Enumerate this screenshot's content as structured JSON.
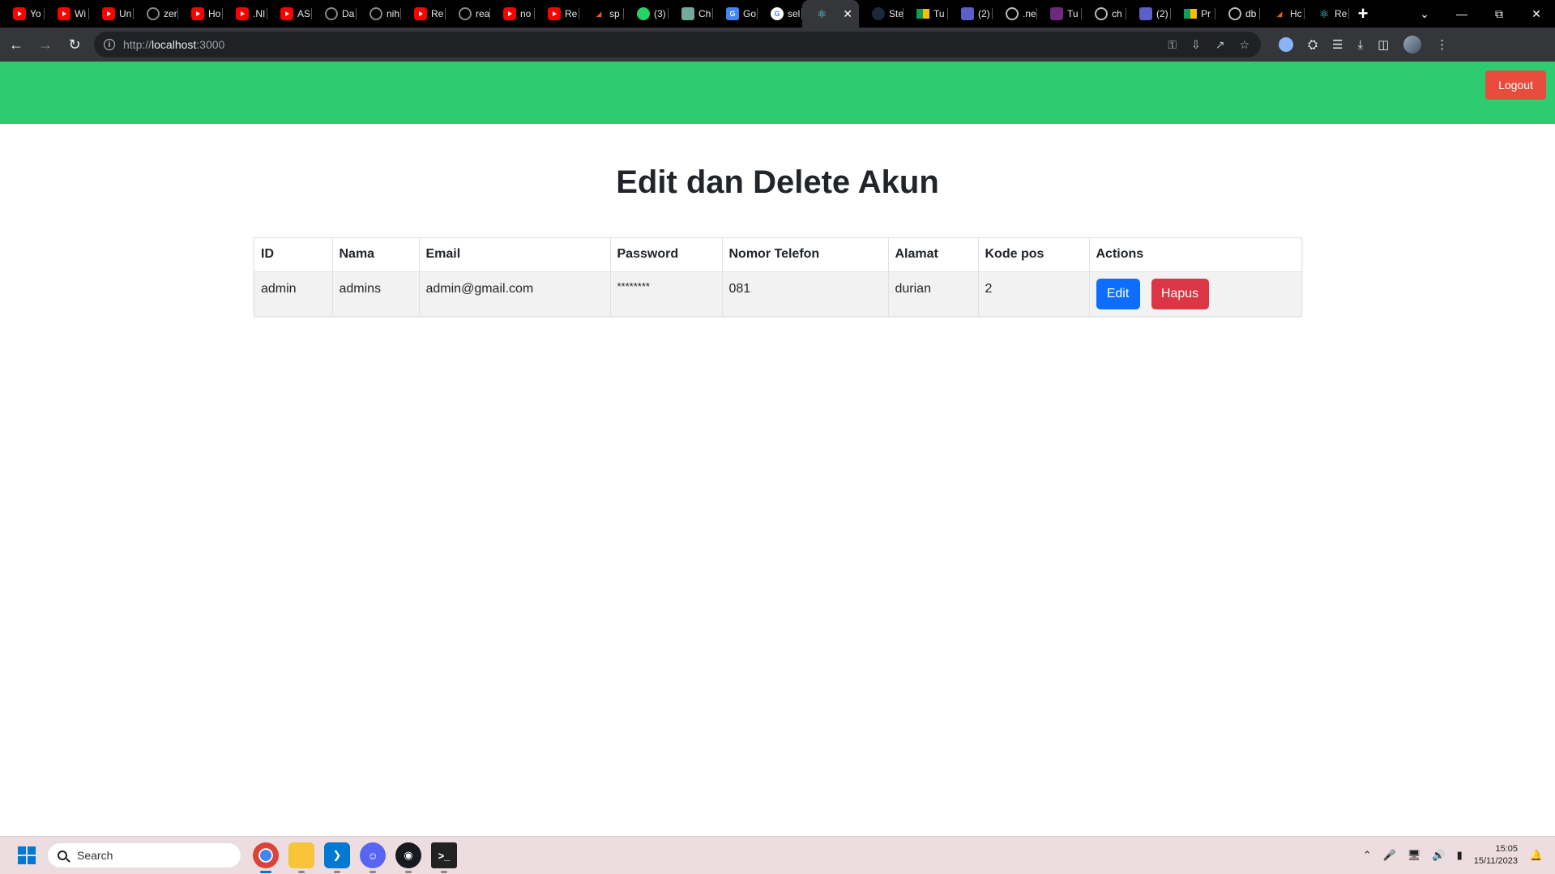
{
  "browser": {
    "tabs": [
      {
        "label": "Yo",
        "icon": "youtube-icon"
      },
      {
        "label": "Wi",
        "icon": "youtube-icon"
      },
      {
        "label": "Un",
        "icon": "youtube-icon"
      },
      {
        "label": "zer",
        "icon": "github-icon"
      },
      {
        "label": "Ho",
        "icon": "youtube-icon"
      },
      {
        "label": ".NI",
        "icon": "youtube-icon"
      },
      {
        "label": "AS",
        "icon": "youtube-icon"
      },
      {
        "label": "Da",
        "icon": "github-icon"
      },
      {
        "label": "nih",
        "icon": "github-icon"
      },
      {
        "label": "Re",
        "icon": "youtube-icon"
      },
      {
        "label": "rea",
        "icon": "github-icon"
      },
      {
        "label": "no",
        "icon": "youtube-icon"
      },
      {
        "label": "Re",
        "icon": "youtube-icon"
      },
      {
        "label": "sp",
        "icon": "codeium-icon"
      },
      {
        "label": "(3)",
        "icon": "whatsapp-icon"
      },
      {
        "label": "Ch",
        "icon": "chatgpt-icon"
      },
      {
        "label": "Go",
        "icon": "translate-icon"
      },
      {
        "label": "sel",
        "icon": "google-icon"
      },
      {
        "label": "",
        "icon": "react-icon",
        "active": true
      },
      {
        "label": "Ste",
        "icon": "steam-icon"
      },
      {
        "label": "Tu",
        "icon": "drive-icon"
      },
      {
        "label": "(2)",
        "icon": "teams-icon"
      },
      {
        "label": ".ne",
        "icon": "globe-icon"
      },
      {
        "label": "Tu",
        "icon": "magazine-icon"
      },
      {
        "label": "ch",
        "icon": "globe-icon"
      },
      {
        "label": "(2)",
        "icon": "teams-icon"
      },
      {
        "label": "Pr",
        "icon": "drive-icon"
      },
      {
        "label": "db",
        "icon": "globe-icon"
      },
      {
        "label": "Hc",
        "icon": "codeium-icon"
      },
      {
        "label": "Re",
        "icon": "react-icon"
      }
    ],
    "url_host": "localhost",
    "url_prefix": "http://",
    "url_suffix": ":3000"
  },
  "navbar": {
    "logout_label": "Logout",
    "color": "#2ecc71",
    "logout_color": "#e74c3c"
  },
  "page": {
    "title": "Edit dan Delete Akun"
  },
  "table": {
    "headers": {
      "id": "ID",
      "nama": "Nama",
      "email": "Email",
      "password": "Password",
      "phone": "Nomor Telefon",
      "alamat": "Alamat",
      "kodepos": "Kode pos",
      "actions": "Actions"
    },
    "rows": [
      {
        "id": "admin",
        "nama": "admins",
        "email": "admin@gmail.com",
        "password": "********",
        "phone": "081",
        "alamat": "durian",
        "kodepos": "2",
        "edit_label": "Edit",
        "delete_label": "Hapus"
      }
    ],
    "edit_color": "#0d6efd",
    "delete_color": "#dc3545"
  },
  "taskbar": {
    "search_placeholder": "Search",
    "time": "15:05",
    "date": "15/11/2023"
  }
}
